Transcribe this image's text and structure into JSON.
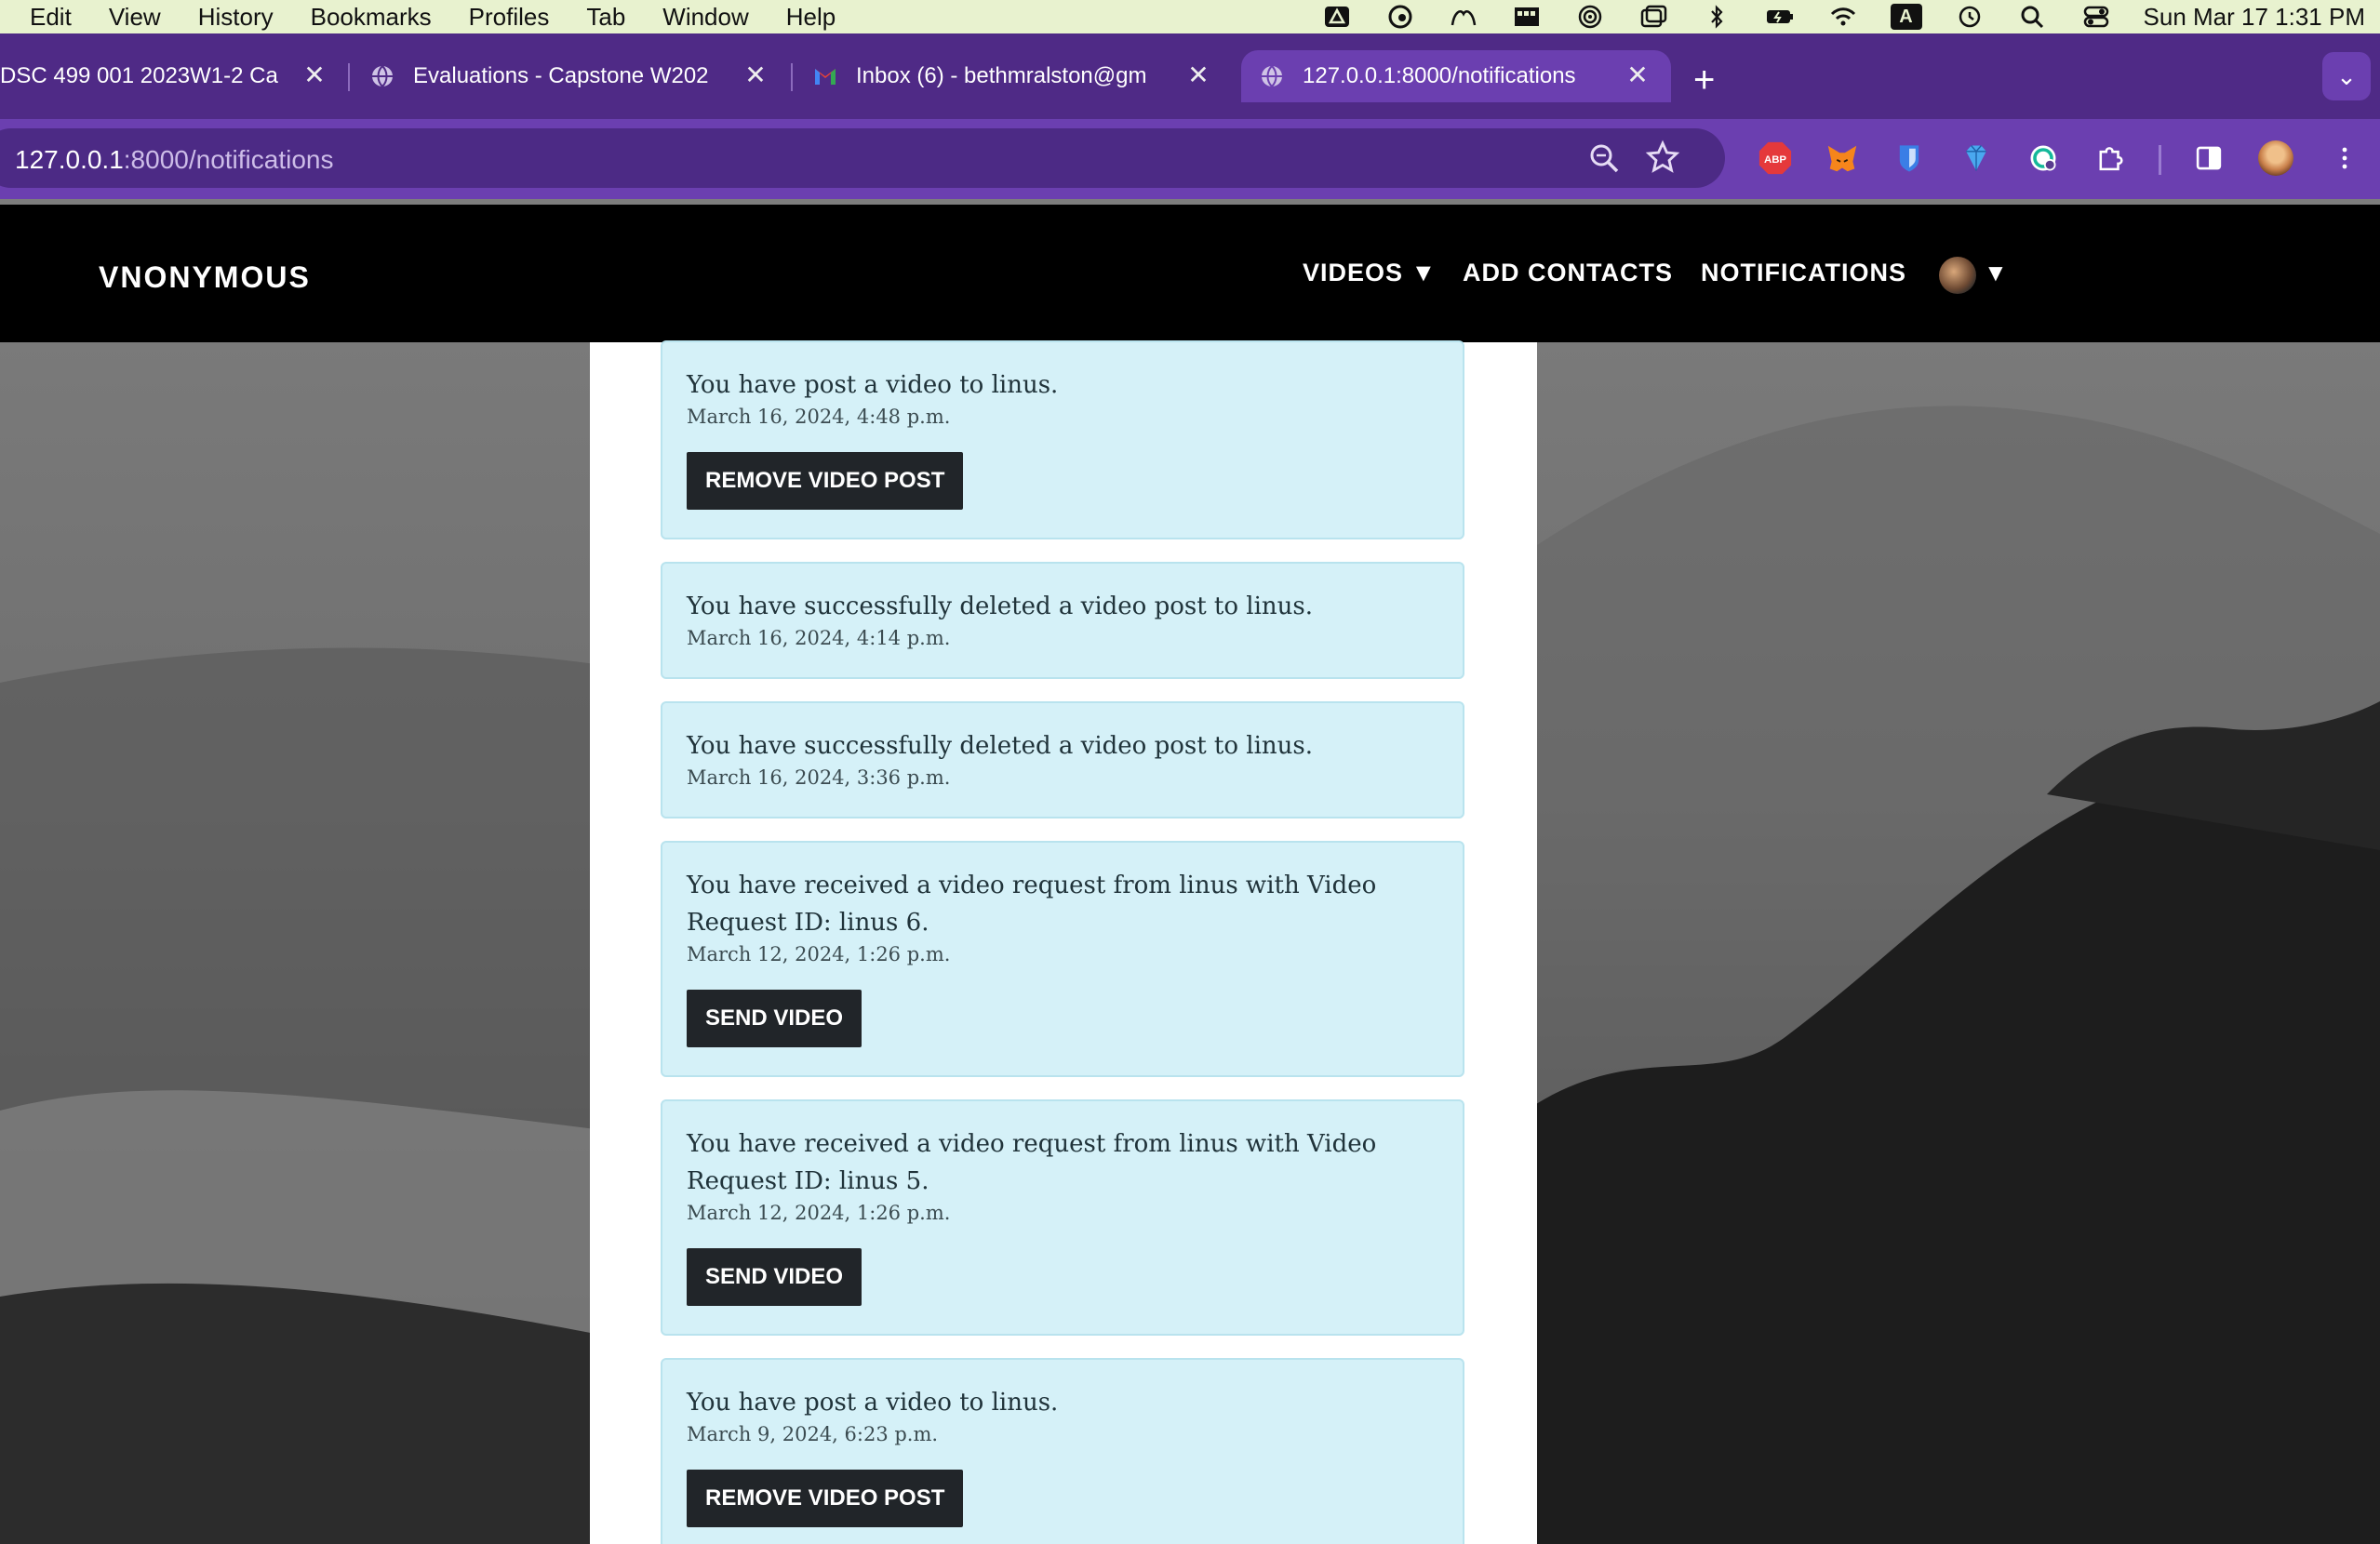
{
  "menubar": {
    "items": [
      "Edit",
      "View",
      "History",
      "Bookmarks",
      "Profiles",
      "Tab",
      "Window",
      "Help"
    ],
    "clock": "Sun Mar 17  1:31 PM",
    "status_icons": [
      "google-drive-icon",
      "grammarly-icon",
      "creative-cloud-icon",
      "dock-icon",
      "airdrop-icon",
      "window-icon",
      "bluetooth-icon",
      "battery-icon",
      "wifi-icon",
      "input-source-icon",
      "time-machine-icon",
      "spotlight-icon",
      "control-center-icon"
    ],
    "input_source_label": "A"
  },
  "tabs": [
    {
      "title": "DSC 499 001 2023W1-2 Ca",
      "icon": "canvas-icon"
    },
    {
      "title": "Evaluations - Capstone W202",
      "icon": "globe-icon"
    },
    {
      "title": "Inbox (6) - bethmralston@gm",
      "icon": "gmail-icon"
    },
    {
      "title": "127.0.0.1:8000/notifications",
      "icon": "globe-icon",
      "active": true
    }
  ],
  "omnibox": {
    "host": "127.0.0.1",
    "path": ":8000/notifications"
  },
  "extensions": {
    "abp_label": "ABP"
  },
  "site": {
    "brand": "VNONYMOUS",
    "nav": {
      "videos": "VIDEOS ▼",
      "add_contacts": "ADD CONTACTS",
      "notifications": "NOTIFICATIONS",
      "profile_caret": "▼"
    }
  },
  "notifications": [
    {
      "message": "You have post a video to linus.",
      "date": "March 16, 2024, 4:48 p.m.",
      "button": "REMOVE VIDEO POST"
    },
    {
      "message": "You have successfully deleted a video post to linus.",
      "date": "March 16, 2024, 4:14 p.m."
    },
    {
      "message": "You have successfully deleted a video post to linus.",
      "date": "March 16, 2024, 3:36 p.m."
    },
    {
      "message": "You have received a video request from linus with Video Request ID: linus 6.",
      "date": "March 12, 2024, 1:26 p.m.",
      "button": "SEND VIDEO"
    },
    {
      "message": "You have received a video request from linus with Video Request ID: linus 5.",
      "date": "March 12, 2024, 1:26 p.m.",
      "button": "SEND VIDEO"
    },
    {
      "message": "You have post a video to linus.",
      "date": "March 9, 2024, 6:23 p.m.",
      "button": "REMOVE VIDEO POST"
    }
  ],
  "colors": {
    "menubar_bg": "#e8f2cf",
    "browser_frame": "#4f2a86",
    "active_tab": "#6b3fb0",
    "card_bg": "#d5f1f8",
    "button_bg": "#212529"
  }
}
